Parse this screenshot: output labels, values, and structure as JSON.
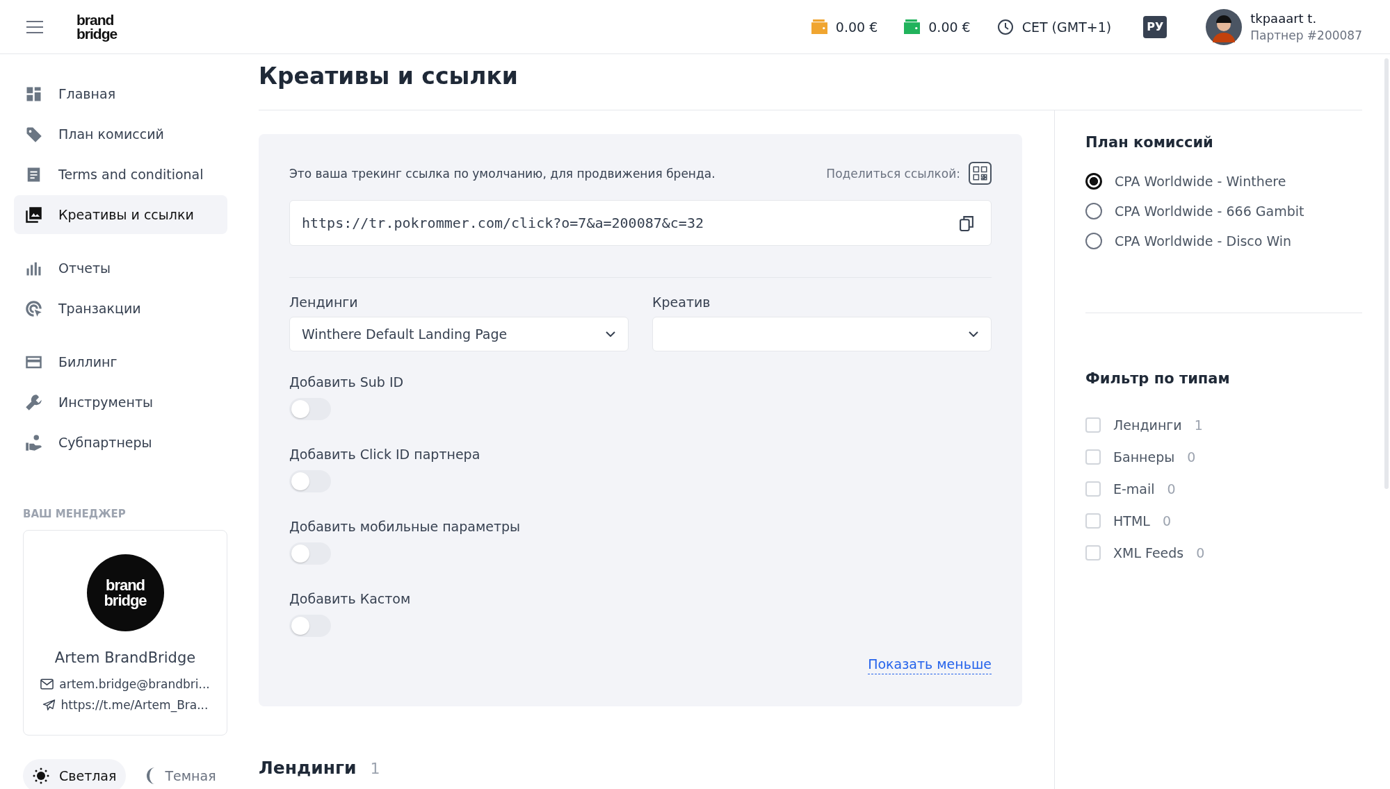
{
  "header": {
    "logo": [
      "brand",
      "bridge"
    ],
    "balances": [
      {
        "amount": "0.00 €",
        "color": "#f0a530"
      },
      {
        "amount": "0.00 €",
        "color": "#21b35c"
      }
    ],
    "timezone": "CET (GMT+1)",
    "language": "РУ",
    "user": {
      "name": "tkpaaart t.",
      "partner_id": "Партнер #200087"
    }
  },
  "sidebar": {
    "groups": [
      [
        {
          "label": "Главная",
          "selected": false
        },
        {
          "label": "План комиссий",
          "selected": false
        },
        {
          "label": "Terms and conditional",
          "selected": false
        },
        {
          "label": "Креативы и ссылки",
          "selected": true
        }
      ],
      [
        {
          "label": "Отчеты",
          "selected": false
        },
        {
          "label": "Транзакции",
          "selected": false
        }
      ],
      [
        {
          "label": "Биллинг",
          "selected": false
        },
        {
          "label": "Инструменты",
          "selected": false
        },
        {
          "label": "Субпартнеры",
          "selected": false
        }
      ]
    ],
    "manager": {
      "heading": "ВАШ МЕНЕДЖЕР",
      "logo": [
        "brand",
        "bridge"
      ],
      "name": "Artem BrandBridge",
      "email": "artem.bridge@brandbri...",
      "telegram": "https://t.me/Artem_Bra..."
    },
    "themes": [
      {
        "label": "Светлая",
        "selected": true
      },
      {
        "label": "Темная",
        "selected": false
      }
    ]
  },
  "page": {
    "title": "Креативы и ссылки",
    "link_card": {
      "description": "Это ваша трекинг ссылка по умолчанию, для продвижения бренда.",
      "share_label": "Поделиться ссылкой:",
      "url": "https://tr.pokrommer.com/click?o=7&a=200087&c=32",
      "selects": [
        {
          "label": "Лендинги",
          "value": "Winthere Default Landing Page"
        },
        {
          "label": "Креатив"
        }
      ],
      "toggles": [
        {
          "label": "Добавить Sub ID",
          "on": false
        },
        {
          "label": "Добавить Click ID партнера",
          "on": false
        },
        {
          "label": "Добавить мобильные параметры",
          "on": false
        },
        {
          "label": "Добавить Кастом",
          "on": false
        }
      ],
      "show_less": "Показать меньше"
    },
    "section": {
      "title": "Лендинги",
      "count": "1"
    }
  },
  "right_panel": {
    "plan": {
      "title": "План комиссий",
      "options": [
        {
          "label": "CPA Worldwide - Winthere",
          "selected": true
        },
        {
          "label": "CPA Worldwide - 666 Gambit",
          "selected": false
        },
        {
          "label": "CPA Worldwide - Disco Win",
          "selected": false
        }
      ]
    },
    "filter": {
      "title": "Фильтр по типам",
      "options": [
        {
          "label": "Лендинги",
          "count": "1",
          "checked": false
        },
        {
          "label": "Баннеры",
          "count": "0",
          "checked": false
        },
        {
          "label": "E-mail",
          "count": "0",
          "checked": false
        },
        {
          "label": "HTML",
          "count": "0",
          "checked": false
        },
        {
          "label": "XML Feeds",
          "count": "0",
          "checked": false
        }
      ]
    }
  }
}
